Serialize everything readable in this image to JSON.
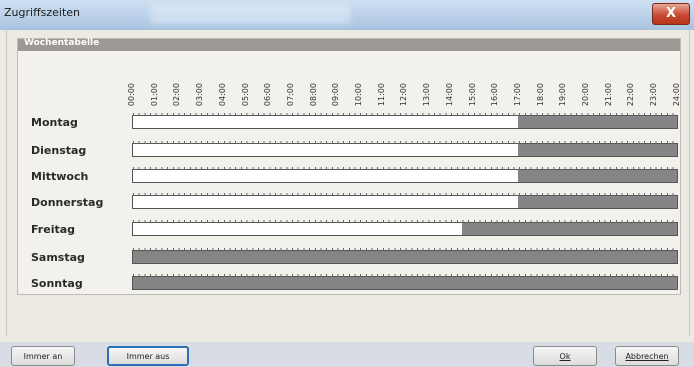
{
  "window": {
    "title": "Zugriffszeiten",
    "close_label": "X"
  },
  "group": {
    "title": "Wochentabelle"
  },
  "hours": [
    "00:00",
    "01:00",
    "02:00",
    "03:00",
    "04:00",
    "05:00",
    "06:00",
    "07:00",
    "08:00",
    "09:00",
    "10:00",
    "11:00",
    "12:00",
    "13:00",
    "14:00",
    "15:00",
    "16:00",
    "17:00",
    "18:00",
    "19:00",
    "20:00",
    "21:00",
    "22:00",
    "23:00",
    "24:00"
  ],
  "days": [
    {
      "label": "Montag",
      "allowed_until_hour": 17
    },
    {
      "label": "Dienstag",
      "allowed_until_hour": 17
    },
    {
      "label": "Mittwoch",
      "allowed_until_hour": 17
    },
    {
      "label": "Donnerstag",
      "allowed_until_hour": 17
    },
    {
      "label": "Freitag",
      "allowed_until_hour": 14.5
    },
    {
      "label": "Samstag",
      "allowed_until_hour": 0
    },
    {
      "label": "Sonntag",
      "allowed_until_hour": 0
    }
  ],
  "buttons": {
    "always_on": "Immer an",
    "always_off": "Immer aus",
    "ok": "Ok",
    "cancel": "Abbrechen"
  },
  "colors": {
    "allowed": "#ffffff",
    "blocked": "#858585"
  }
}
